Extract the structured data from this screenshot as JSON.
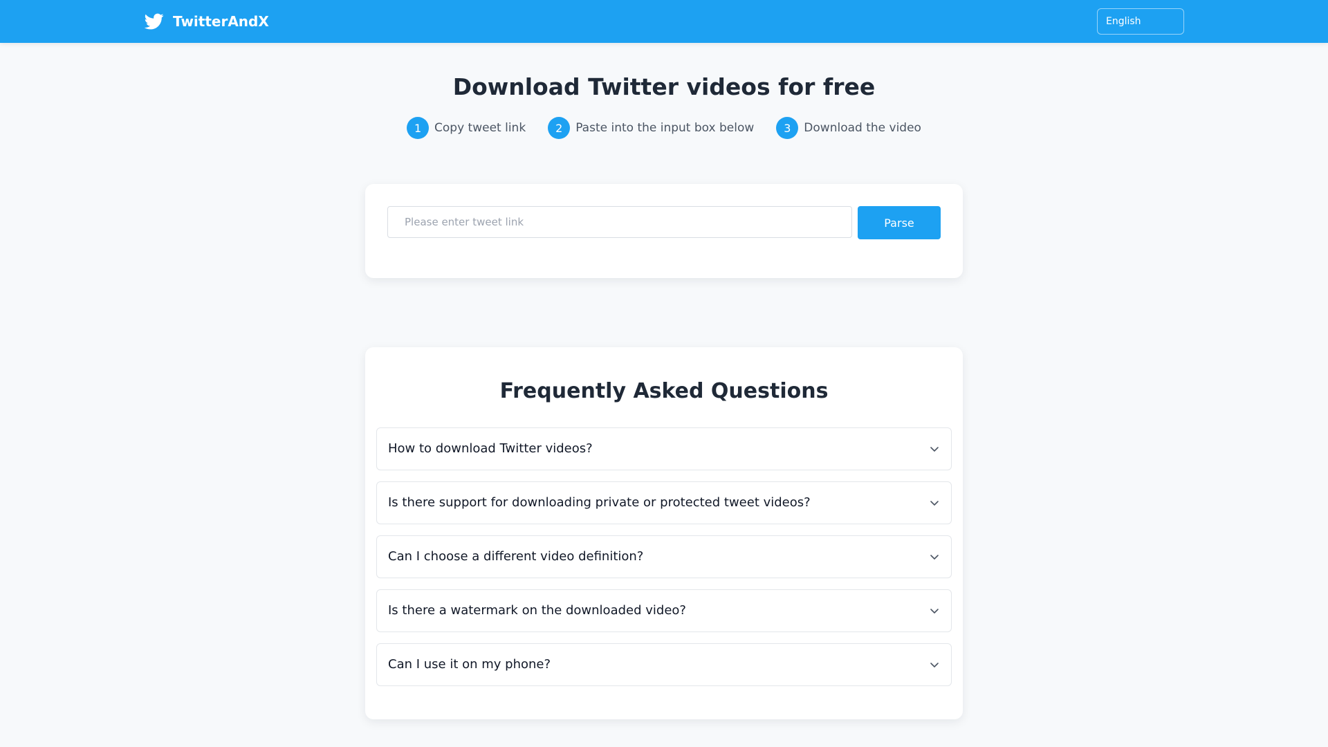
{
  "header": {
    "brand_name": "TwitterAndX",
    "brand_icon": "twitter-bird-icon",
    "language_label": "English"
  },
  "hero": {
    "title": "Download Twitter videos for free",
    "steps": [
      {
        "num": "1",
        "text": "Copy tweet link"
      },
      {
        "num": "2",
        "text": "Paste into the input box below"
      },
      {
        "num": "3",
        "text": "Download the video"
      }
    ]
  },
  "parser": {
    "placeholder": "Please enter tweet link",
    "value": "",
    "button_label": "Parse"
  },
  "faq": {
    "title": "Frequently Asked Questions",
    "items": [
      {
        "question": "How to download Twitter videos?"
      },
      {
        "question": "Is there support for downloading private or protected tweet videos?"
      },
      {
        "question": "Can I choose a different video definition?"
      },
      {
        "question": "Is there a watermark on the downloaded video?"
      },
      {
        "question": "Can I use it on my phone?"
      }
    ],
    "toggle_icon": "chevron-down-icon"
  },
  "colors": {
    "brand": "#1da1f2",
    "background": "#f7f9fb",
    "text": "#1f2937"
  }
}
